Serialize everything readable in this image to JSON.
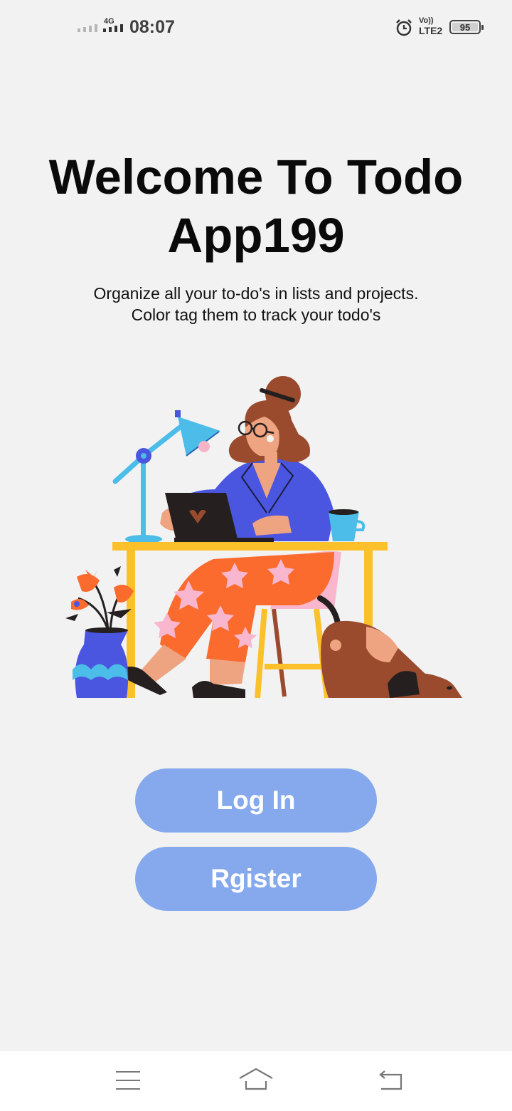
{
  "status_bar": {
    "network": "4G",
    "time": "08:07",
    "volte_top": "Vo))",
    "volte_bottom": "LTE2",
    "battery": "95",
    "icons": [
      "signal-icon",
      "alarm-icon",
      "battery-icon"
    ]
  },
  "welcome": {
    "title": "Welcome To Todo App199",
    "subtitle_line1": "Organize all your to-do's in lists and projects.",
    "subtitle_line2": "Color tag them to track your todo's"
  },
  "buttons": {
    "login": "Log In",
    "register": "Rgister"
  },
  "nav": {
    "icons": [
      "menu-icon",
      "home-icon",
      "back-icon"
    ]
  },
  "colors": {
    "background": "#f2f2f3",
    "button": "#85a9ec",
    "button_text": "#ffffff",
    "nav_bar": "#ffffff"
  }
}
